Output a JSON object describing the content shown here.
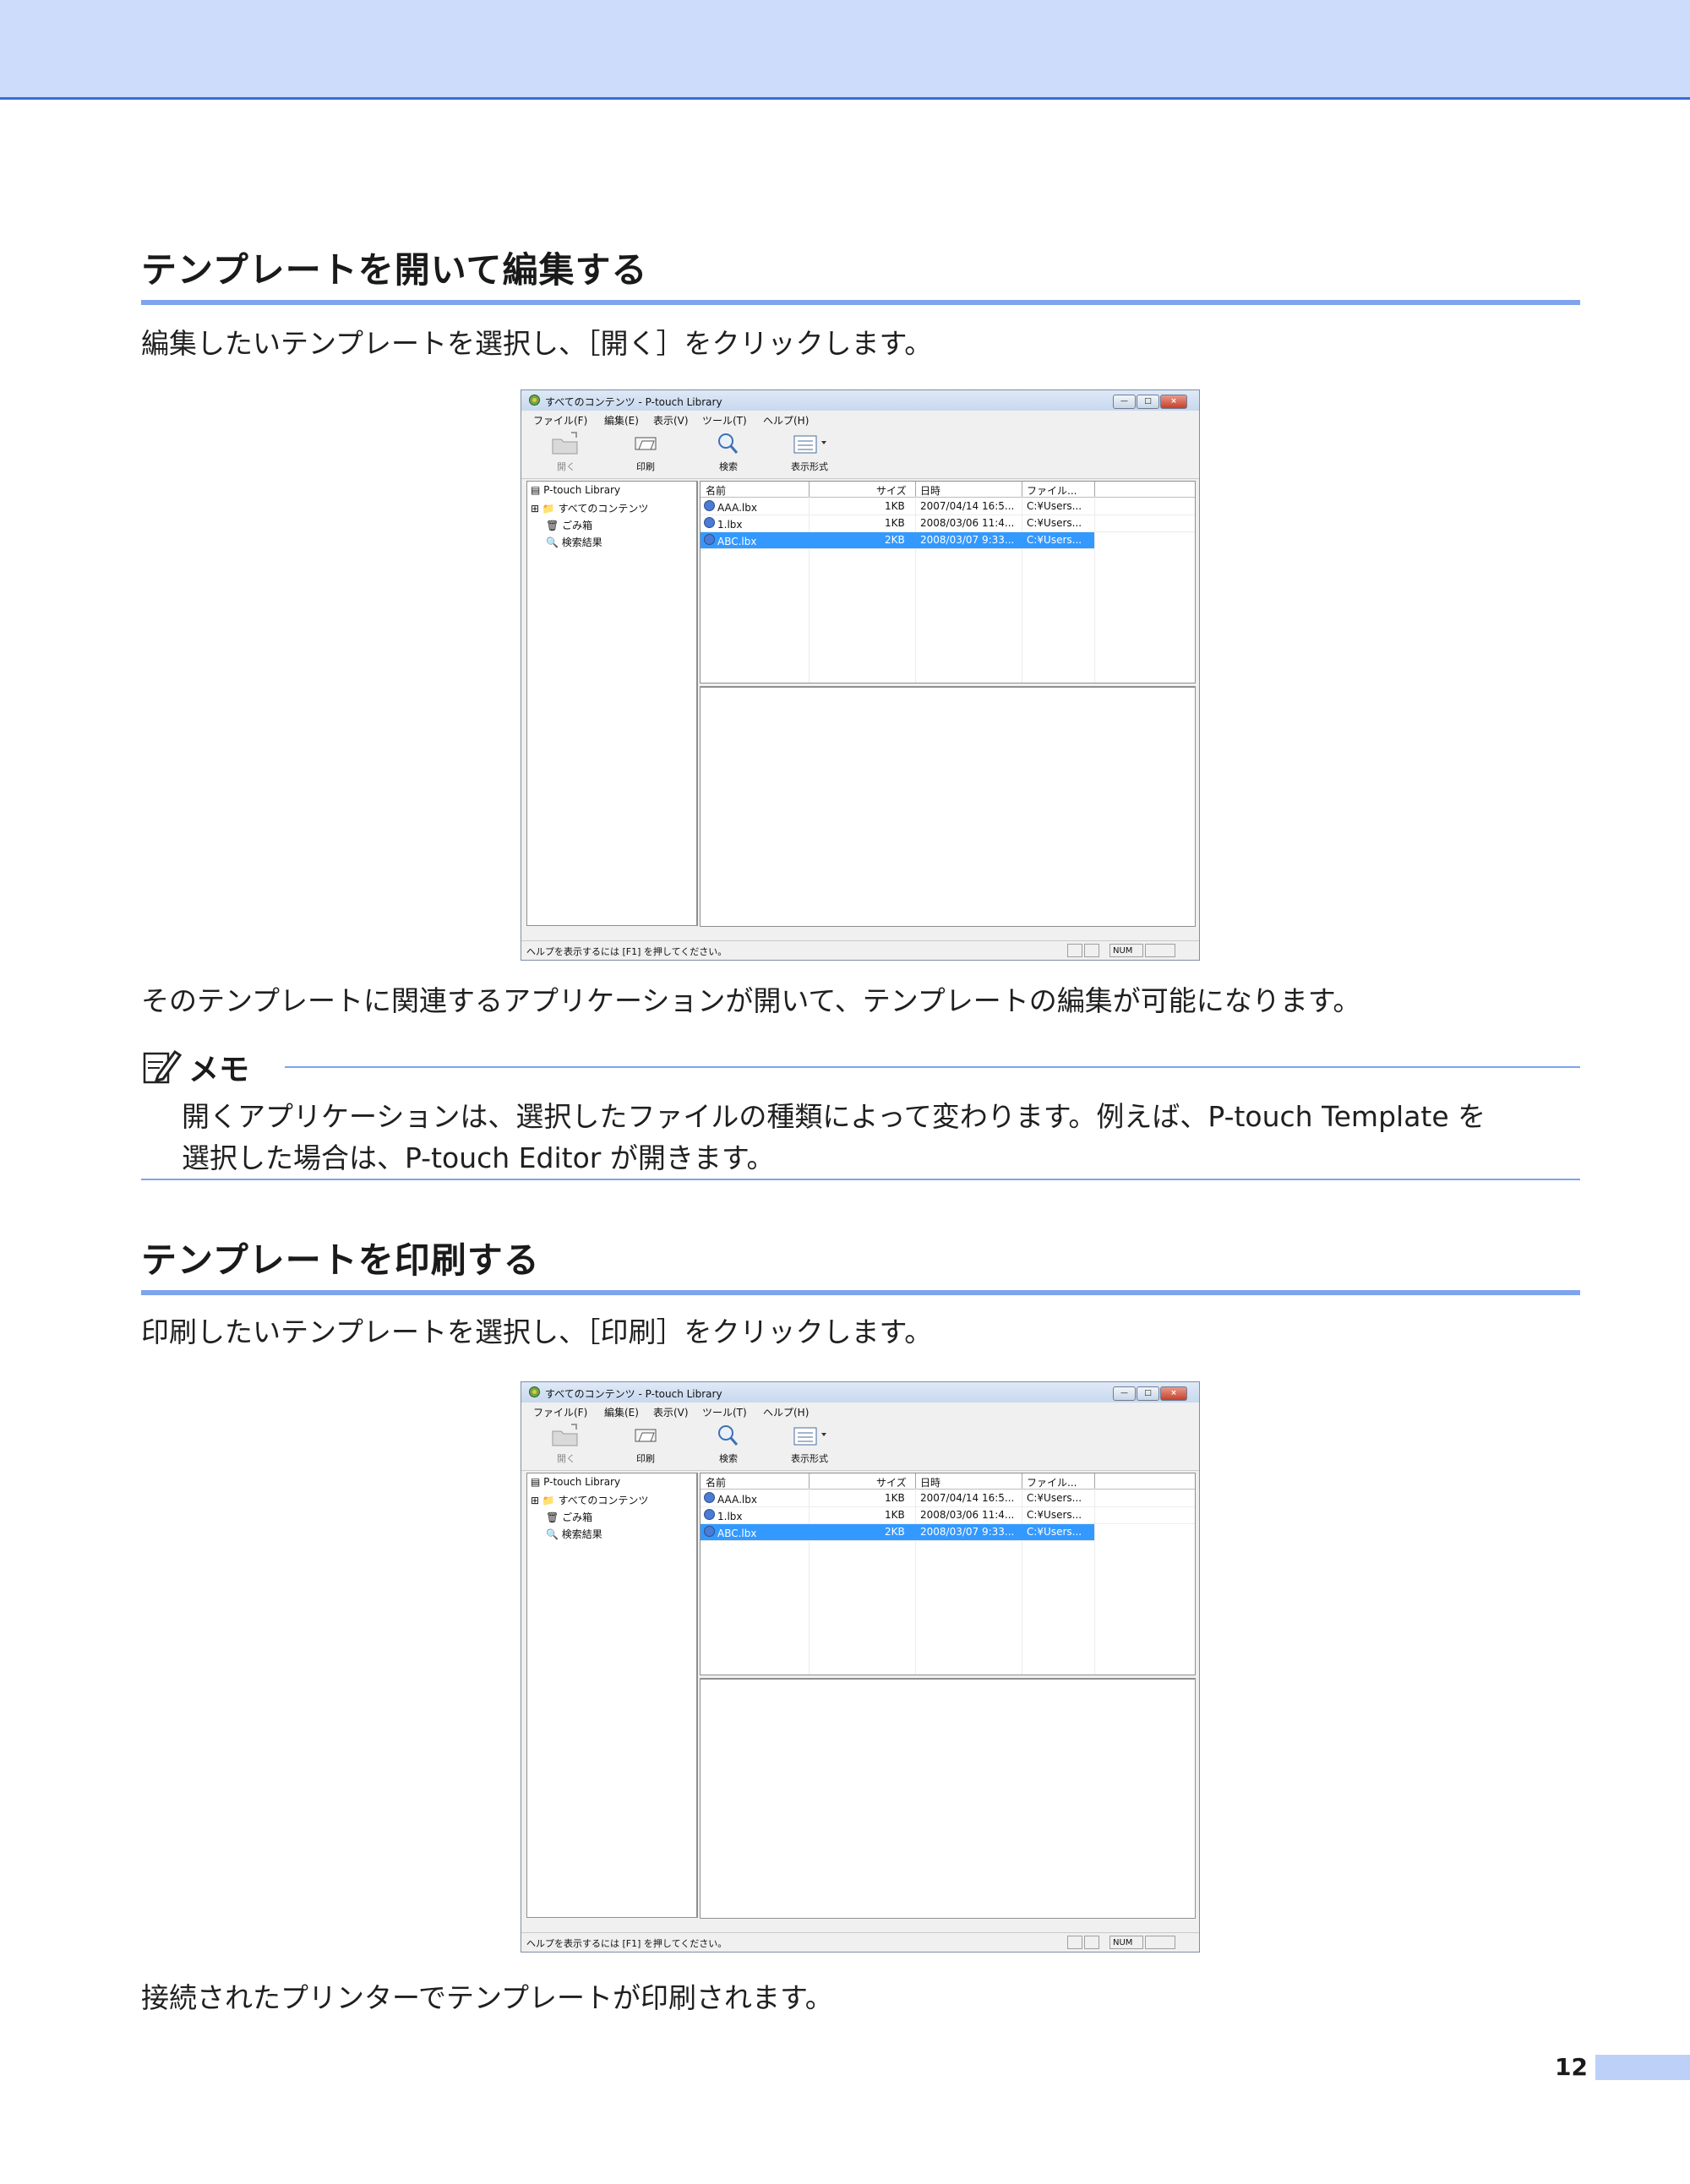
{
  "section1": {
    "heading": "テンプレートを開いて編集する",
    "instruction": "編集したいテンプレートを選択し、［開く］をクリックします。",
    "result": "そのテンプレートに関連するアプリケーションが開いて、テンプレートの編集が可能になります。"
  },
  "memo": {
    "title": "メモ",
    "line1": "開くアプリケーションは、選択したファイルの種類によって変わります。例えば、P-touch Template を",
    "line2": "選択した場合は、P-touch Editor が開きます。"
  },
  "section2": {
    "heading": "テンプレートを印刷する",
    "instruction": "印刷したいテンプレートを選択し、［印刷］をクリックします。",
    "result": "接続されたプリンターでテンプレートが印刷されます。"
  },
  "window": {
    "title": "すべてのコンテンツ - P-touch Library",
    "controls": [
      "—",
      "□",
      "×"
    ],
    "menu": [
      "ファイル(F)",
      "編集(E)",
      "表示(V)",
      "ツール(T)",
      "ヘルプ(H)"
    ],
    "toolbar": {
      "open": "開く",
      "print": "印刷",
      "search": "検索",
      "view": "表示形式"
    },
    "tree": [
      "P-touch Library",
      "すべてのコンテンツ",
      "ごみ箱",
      "検索結果"
    ],
    "tree_expander": "⊞",
    "columns": {
      "name": "名前",
      "size": "サイズ",
      "date": "日時",
      "file": "ファイル..."
    },
    "rows": [
      {
        "name": "AAA.lbx",
        "size": "1KB",
        "date": "2007/04/14 16:5...",
        "file": "C:¥Users..."
      },
      {
        "name": "1.lbx",
        "size": "1KB",
        "date": "2008/03/06 11:4...",
        "file": "C:¥Users..."
      },
      {
        "name": "ABC.lbx",
        "size": "2KB",
        "date": "2008/03/07 9:33...",
        "file": "C:¥Users..."
      }
    ],
    "status_text": "ヘルプを表示するには [F1] を押してください。",
    "status_num": "NUM"
  },
  "page_number": "12",
  "colors": {
    "accent": "#7ea4ee",
    "band": "#cddcfb",
    "selection": "#3399ff"
  }
}
